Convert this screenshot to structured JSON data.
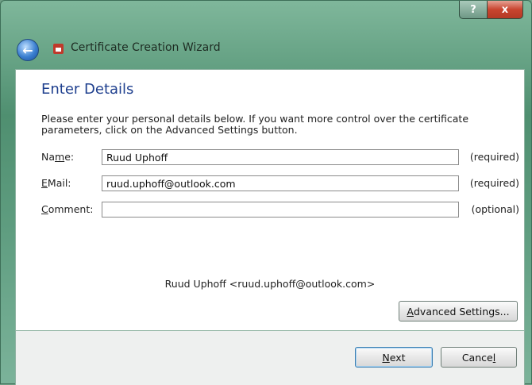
{
  "window": {
    "title": "Certificate Creation Wizard",
    "help_label": "?",
    "close_label": "x"
  },
  "page": {
    "heading": "Enter Details",
    "description": "Please enter your personal details below. If you want more control over the certificate parameters, click on the Advanced Settings button."
  },
  "form": {
    "name": {
      "label_prefix": "Na",
      "label_mnemonic": "m",
      "label_suffix": "e:",
      "value": "Ruud Uphoff",
      "note": "(required)"
    },
    "email": {
      "label_mnemonic": "E",
      "label_suffix": "Mail:",
      "value": "ruud.uphoff@outlook.com",
      "note": "(required)"
    },
    "comment": {
      "label_mnemonic": "C",
      "label_suffix": "omment:",
      "value": "",
      "note": "(optional)"
    }
  },
  "preview": "Ruud Uphoff <ruud.uphoff@outlook.com>",
  "buttons": {
    "advanced_mnemonic": "A",
    "advanced_suffix": "dvanced Settings...",
    "next_mnemonic": "N",
    "next_suffix": "ext",
    "cancel_prefix": "Cance",
    "cancel_mnemonic": "l"
  }
}
